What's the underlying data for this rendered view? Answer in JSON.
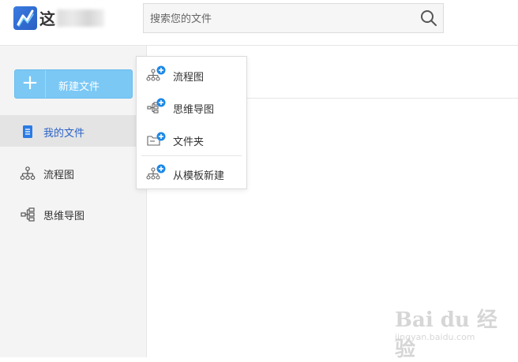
{
  "header": {
    "logo_text": "这",
    "search": {
      "placeholder": "搜索您的文件",
      "value": ""
    }
  },
  "sidebar": {
    "new_button_label": "新建文件",
    "items": [
      {
        "label": "我的文件",
        "icon": "file-icon",
        "active": true
      },
      {
        "label": "流程图",
        "icon": "flowchart-icon",
        "active": false
      },
      {
        "label": "思维导图",
        "icon": "mindmap-icon",
        "active": false
      }
    ]
  },
  "dropdown": {
    "items": [
      {
        "label": "流程图",
        "icon": "new-flowchart-icon"
      },
      {
        "label": "思维导图",
        "icon": "new-mindmap-icon"
      },
      {
        "label": "文件夹",
        "icon": "new-folder-icon"
      },
      {
        "label": "从模板新建",
        "icon": "new-from-template-icon"
      }
    ]
  },
  "watermark": {
    "brand": "Bai du 经验",
    "url": "jingyan.baidu.com"
  },
  "colors": {
    "accent_blue": "#2a62c8",
    "new_button": "#7bc8f5",
    "plus_badge": "#1e88e5"
  }
}
